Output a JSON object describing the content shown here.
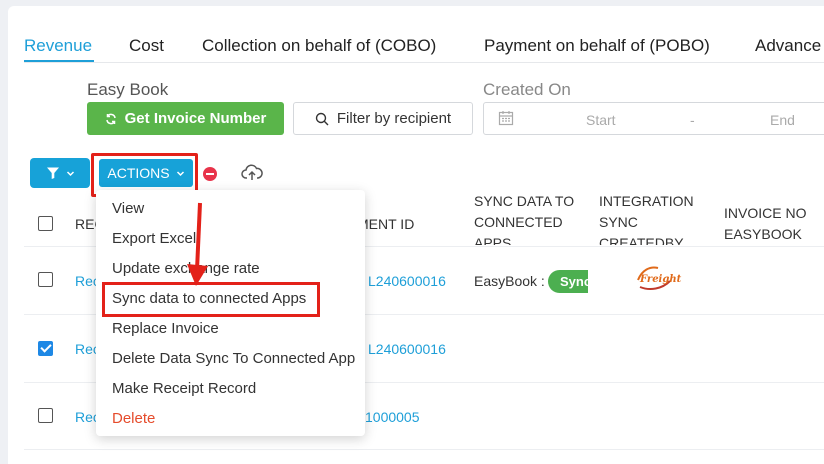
{
  "tabs": [
    {
      "label": "Revenue",
      "active": true
    },
    {
      "label": "Cost"
    },
    {
      "label": "Collection on behalf of (COBO)"
    },
    {
      "label": "Payment on behalf of (POBO)"
    },
    {
      "label": "Advance"
    }
  ],
  "filters": {
    "easybook_label": "Easy Book",
    "get_invoice_label": "Get Invoice Number",
    "filter_recipient_label": "Filter by recipient",
    "created_on_label": "Created On",
    "start_placeholder": "Start",
    "range_separator": "-",
    "end_placeholder": "End"
  },
  "toolbar": {
    "actions_label": "ACTIONS"
  },
  "table": {
    "headers": {
      "rec": "REC",
      "payment_id": "MENT ID",
      "sync_data": "SYNC DATA TO CONNECTED APPS",
      "integration": "INTEGRATION SYNC CREATEDBY",
      "invoice_no": "INVOICE NO EASYBOOK"
    },
    "rows": [
      {
        "rec": "Rec",
        "payment_id": "L240600016",
        "sync_prefix": "EasyBook :",
        "sync_badge": "Sync",
        "checked": false,
        "logo_text": "Freight"
      },
      {
        "rec": "Rec",
        "payment_id": "L240600016",
        "checked": true
      },
      {
        "rec": "Rec",
        "payment_id": "1000005",
        "checked": false
      }
    ]
  },
  "menu": {
    "items": [
      {
        "label": "View"
      },
      {
        "label": "Export Excel"
      },
      {
        "label": "Update exchange rate"
      },
      {
        "label": "Sync data to connected Apps"
      },
      {
        "label": "Replace Invoice"
      },
      {
        "label": "Delete Data Sync To Connected App"
      },
      {
        "label": "Make Receipt Record"
      },
      {
        "label": "Delete"
      }
    ]
  },
  "colors": {
    "accent": "#1e9fd8",
    "green": "#5ab54a",
    "highlight": "#e32119",
    "danger": "#e54b2b"
  }
}
